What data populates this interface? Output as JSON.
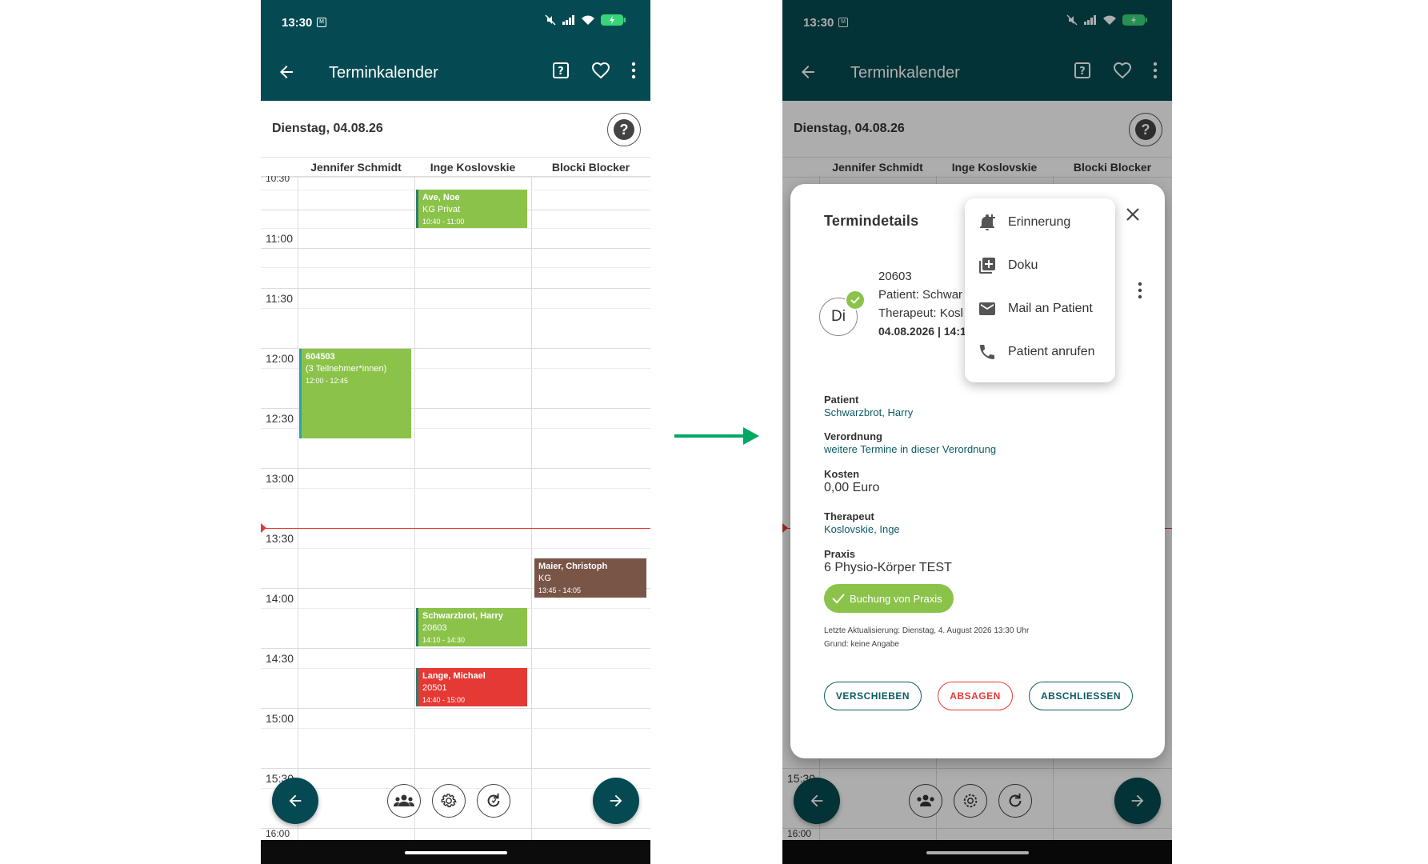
{
  "colors": {
    "primary": "#054a52",
    "green": "#8bc34a",
    "red": "#e53935",
    "brown": "#795548",
    "link": "#0d5c63",
    "connector": "#00a862"
  },
  "statusbar": {
    "time": "13:30",
    "sim_icon": "sim-icon"
  },
  "appbar": {
    "title": "Terminkalender",
    "back_icon": "arrow-left-icon",
    "help_icon": "help-box-icon",
    "favorite_icon": "heart-icon",
    "menu_icon": "more-vert-icon"
  },
  "datebar": {
    "date": "Dienstag, 04.08.26",
    "help_label": "?"
  },
  "columns": [
    "Jennifer Schmidt",
    "Inge Koslovskie",
    "Blocki Blocker"
  ],
  "time_labels": [
    "10:30",
    "11:00",
    "11:30",
    "12:00",
    "12:30",
    "13:00",
    "13:30",
    "14:00",
    "14:30",
    "15:00",
    "15:30",
    "16:00"
  ],
  "appointments": [
    {
      "name": "Ave, Noe",
      "sub": "KG Privat",
      "time": "10:40 - 11:00"
    },
    {
      "name": "604503",
      "sub": "(3 Teilnehmer*innen)",
      "time": "12:00 - 12:45"
    },
    {
      "name": "Maier, Christoph",
      "sub": "KG",
      "time": "13:45 - 14:05"
    },
    {
      "name": "Schwarzbrot, Harry",
      "sub": "20603",
      "time": "14:10 - 14:30"
    },
    {
      "name": "Lange, Michael",
      "sub": "20501",
      "time": "14:40 - 15:00"
    }
  ],
  "toolbar": {
    "prev_icon": "arrow-left-icon",
    "group_icon": "group-icon",
    "settings_icon": "gear-icon",
    "refresh_icon": "refresh-icon",
    "next_icon": "arrow-right-icon"
  },
  "dialog": {
    "title": "Termindetails",
    "avatar": "Di",
    "summary": {
      "id": "20603",
      "patient": "Patient: Schwar",
      "therapist": "Therapeut: Kosl",
      "datetime": "04.08.2026 | 14:1"
    },
    "patient_label": "Patient",
    "patient_value": "Schwarzbrot, Harry",
    "verordnung_label": "Verordnung",
    "verordnung_value": "weitere Termine in dieser Verordnung",
    "kosten_label": "Kosten",
    "kosten_value": "0,00 Euro",
    "therapeut_label": "Therapeut",
    "therapeut_value": "Koslovskie, Inge",
    "praxis_label": "Praxis",
    "praxis_value": "6 Physio-Körper TEST",
    "chip": "Buchung von Praxis",
    "meta_update": "Letzte Aktualisierung: Dienstag, 4. August 2026 13:30 Uhr",
    "meta_reason": "Grund: keine Angabe",
    "btn_move": "VERSCHIEBEN",
    "btn_cancel": "ABSAGEN",
    "btn_close": "ABSCHLIESSEN"
  },
  "menu": [
    {
      "label": "Erinnerung",
      "icon": "bell-plus-icon"
    },
    {
      "label": "Doku",
      "icon": "library-add-icon"
    },
    {
      "label": "Mail an Patient",
      "icon": "mail-icon"
    },
    {
      "label": "Patient anrufen",
      "icon": "phone-icon"
    }
  ]
}
